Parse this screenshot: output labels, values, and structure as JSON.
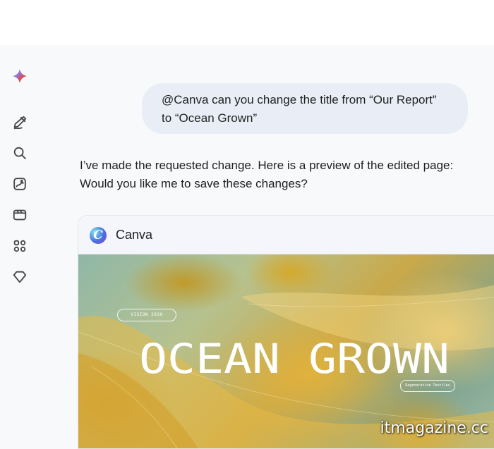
{
  "sidebar": {
    "icons": [
      "gemini-sparkle-icon",
      "new-chat-icon",
      "search-icon",
      "gallery-icon",
      "video-icon",
      "apps-icon",
      "gem-icon"
    ]
  },
  "user_message": {
    "line1": "@Canva can you change the title from “Our Report”",
    "line2": "to “Ocean Grown”"
  },
  "assistant_reply": {
    "line1": "I’ve made the requested change. Here is a preview of the edited page:",
    "line2": "Would you like me to save these changes?"
  },
  "canva_card": {
    "app_name": "Canva",
    "logo_letter": "C",
    "preview": {
      "badge_left": "VISION 2030",
      "title": "OCEAN GROWN",
      "badge_right": "Regenerative Textiles"
    }
  },
  "watermark": "itmagazine.cc",
  "colors": {
    "bubble_bg": "#e9eef6",
    "card_header_bg": "#f4f6fb",
    "page_bg": "#f8f9fb"
  }
}
